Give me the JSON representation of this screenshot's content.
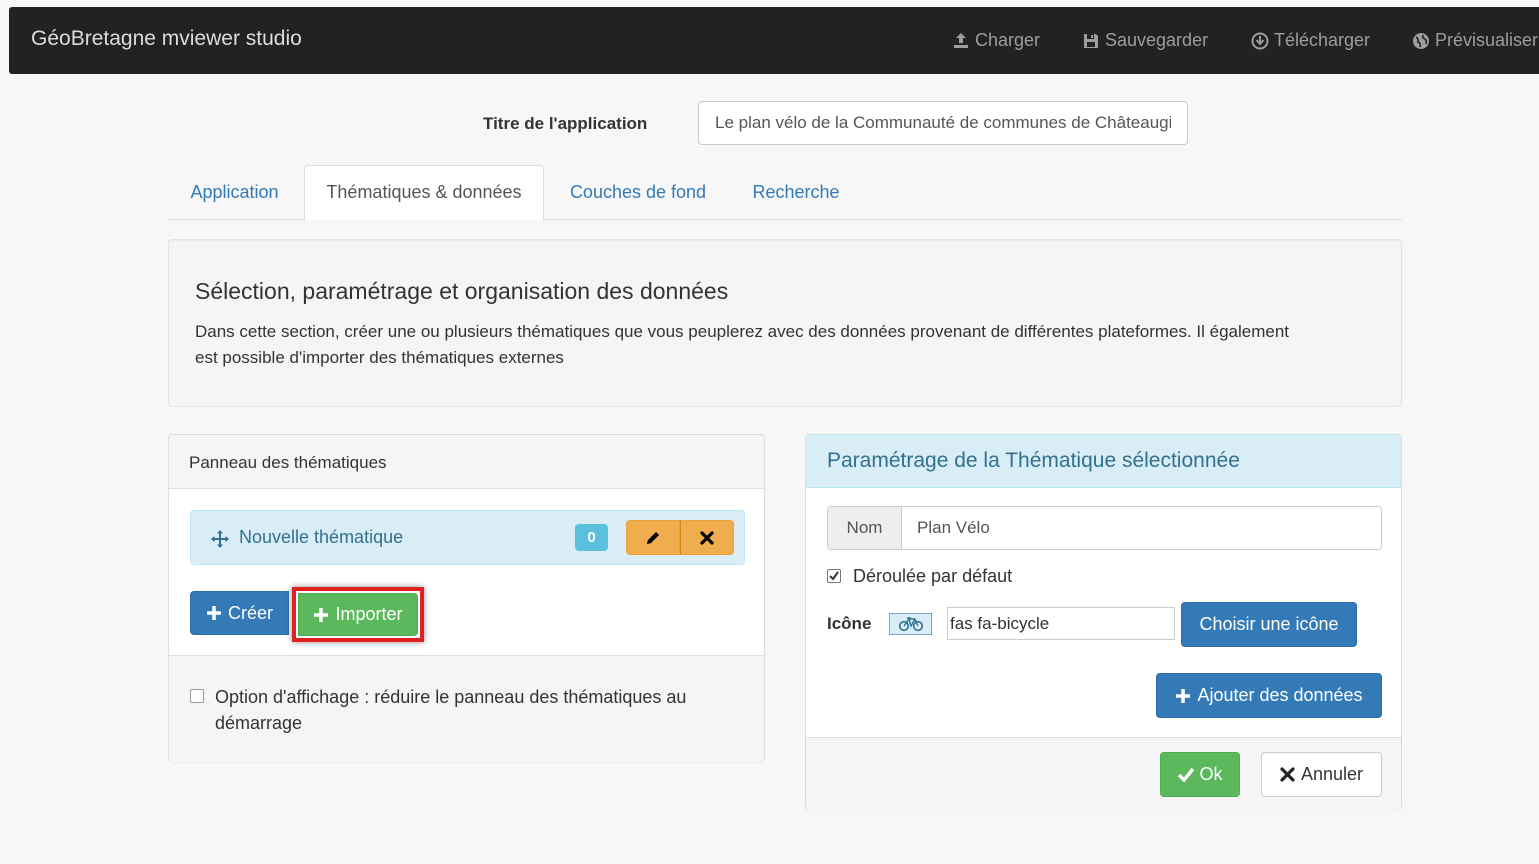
{
  "navbar": {
    "brand": "GéoBretagne mviewer studio",
    "items": [
      {
        "label": "Charger",
        "icon": "upload-icon"
      },
      {
        "label": "Sauvegarder",
        "icon": "floppy-disk-icon"
      },
      {
        "label": "Télécharger",
        "icon": "download-circle-icon"
      },
      {
        "label": "Prévisualiser",
        "icon": "globe-icon"
      }
    ]
  },
  "app_title": {
    "label": "Titre de l'application",
    "value": "Le plan vélo de la Communauté de communes de Châteaugiron"
  },
  "tabs": [
    {
      "label": "Application",
      "active": false
    },
    {
      "label": "Thématiques & données",
      "active": true
    },
    {
      "label": "Couches de fond",
      "active": false
    },
    {
      "label": "Recherche",
      "active": false
    }
  ],
  "intro": {
    "title": "Sélection, paramétrage et organisation des données",
    "text": "Dans cette section, créer une ou plusieurs thématiques que vous peuplerez avec des données provenant de différentes plateformes. Il également est possible d'importer des thématiques externes"
  },
  "themes_panel": {
    "title": "Panneau des thématiques",
    "items": [
      {
        "label": "Nouvelle thématique",
        "count": "0"
      }
    ],
    "create_label": "Créer",
    "import_label": "Importer",
    "option_label": "Option d'affichage : réduire le panneau des thématiques au démarrage",
    "option_checked": false
  },
  "settings_panel": {
    "title": "Paramétrage de la Thématique sélectionnée",
    "name_addon": "Nom",
    "name_value": "Plan Vélo",
    "collapsed_label": "Déroulée par défaut",
    "collapsed_checked": true,
    "icon_label": "Icône",
    "icon_value": "fas fa-bicycle",
    "choose_icon_label": "Choisir une icône",
    "add_data_label": "Ajouter des données",
    "ok_label": "Ok",
    "cancel_label": "Annuler"
  },
  "colors": {
    "navbar_bg": "#222222",
    "primary": "#337ab7",
    "success": "#5cb85c",
    "warning": "#f0ad4e",
    "info": "#5bc0de",
    "highlight": "#e02020"
  }
}
